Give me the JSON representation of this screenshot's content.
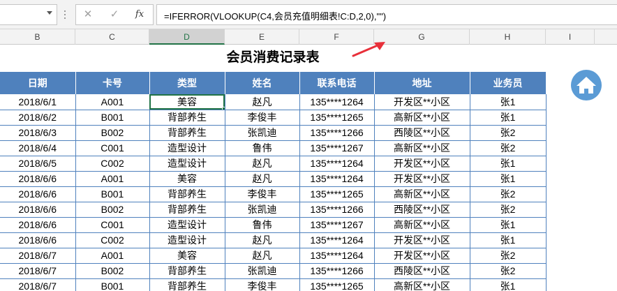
{
  "formula_bar": {
    "name_box": "",
    "cancel_glyph": "✕",
    "enter_glyph": "✓",
    "fx_label": "fx",
    "formula": "=IFERROR(VLOOKUP(C4,会员充值明细表!C:D,2,0),\"\")"
  },
  "column_headers": [
    "B",
    "C",
    "D",
    "E",
    "F",
    "G",
    "H",
    "I"
  ],
  "selected_column": "D",
  "sheet": {
    "title": "会员消费记录表",
    "headers": [
      "日期",
      "卡号",
      "类型",
      "姓名",
      "联系电话",
      "地址",
      "业务员"
    ],
    "rows": [
      [
        "2018/6/1",
        "A001",
        "美容",
        "赵凡",
        "135****1264",
        "开发区**小区",
        "张1"
      ],
      [
        "2018/6/2",
        "B001",
        "背部养生",
        "李俊丰",
        "135****1265",
        "高新区**小区",
        "张1"
      ],
      [
        "2018/6/3",
        "B002",
        "背部养生",
        "张凯迪",
        "135****1266",
        "西陵区**小区",
        "张2"
      ],
      [
        "2018/6/4",
        "C001",
        "造型设计",
        "鲁伟",
        "135****1267",
        "高新区**小区",
        "张2"
      ],
      [
        "2018/6/5",
        "C002",
        "造型设计",
        "赵凡",
        "135****1264",
        "开发区**小区",
        "张1"
      ],
      [
        "2018/6/6",
        "A001",
        "美容",
        "赵凡",
        "135****1264",
        "开发区**小区",
        "张1"
      ],
      [
        "2018/6/6",
        "B001",
        "背部养生",
        "李俊丰",
        "135****1265",
        "高新区**小区",
        "张2"
      ],
      [
        "2018/6/6",
        "B002",
        "背部养生",
        "张凯迪",
        "135****1266",
        "西陵区**小区",
        "张2"
      ],
      [
        "2018/6/6",
        "C001",
        "造型设计",
        "鲁伟",
        "135****1267",
        "高新区**小区",
        "张1"
      ],
      [
        "2018/6/6",
        "C002",
        "造型设计",
        "赵凡",
        "135****1264",
        "开发区**小区",
        "张1"
      ],
      [
        "2018/6/7",
        "A001",
        "美容",
        "赵凡",
        "135****1264",
        "开发区**小区",
        "张2"
      ],
      [
        "2018/6/7",
        "B002",
        "背部养生",
        "张凯迪",
        "135****1266",
        "西陵区**小区",
        "张2"
      ],
      [
        "2018/6/7",
        "B001",
        "背部养生",
        "李俊丰",
        "135****1265",
        "高新区**小区",
        "张1"
      ]
    ]
  },
  "colors": {
    "header_fill": "#4f81bd",
    "annotation_arrow": "#e8303a",
    "home_button": "#5b9bd5",
    "selection": "#217346"
  },
  "icons": {
    "home": "home-icon",
    "annotation": "red-arrow-annotation"
  }
}
